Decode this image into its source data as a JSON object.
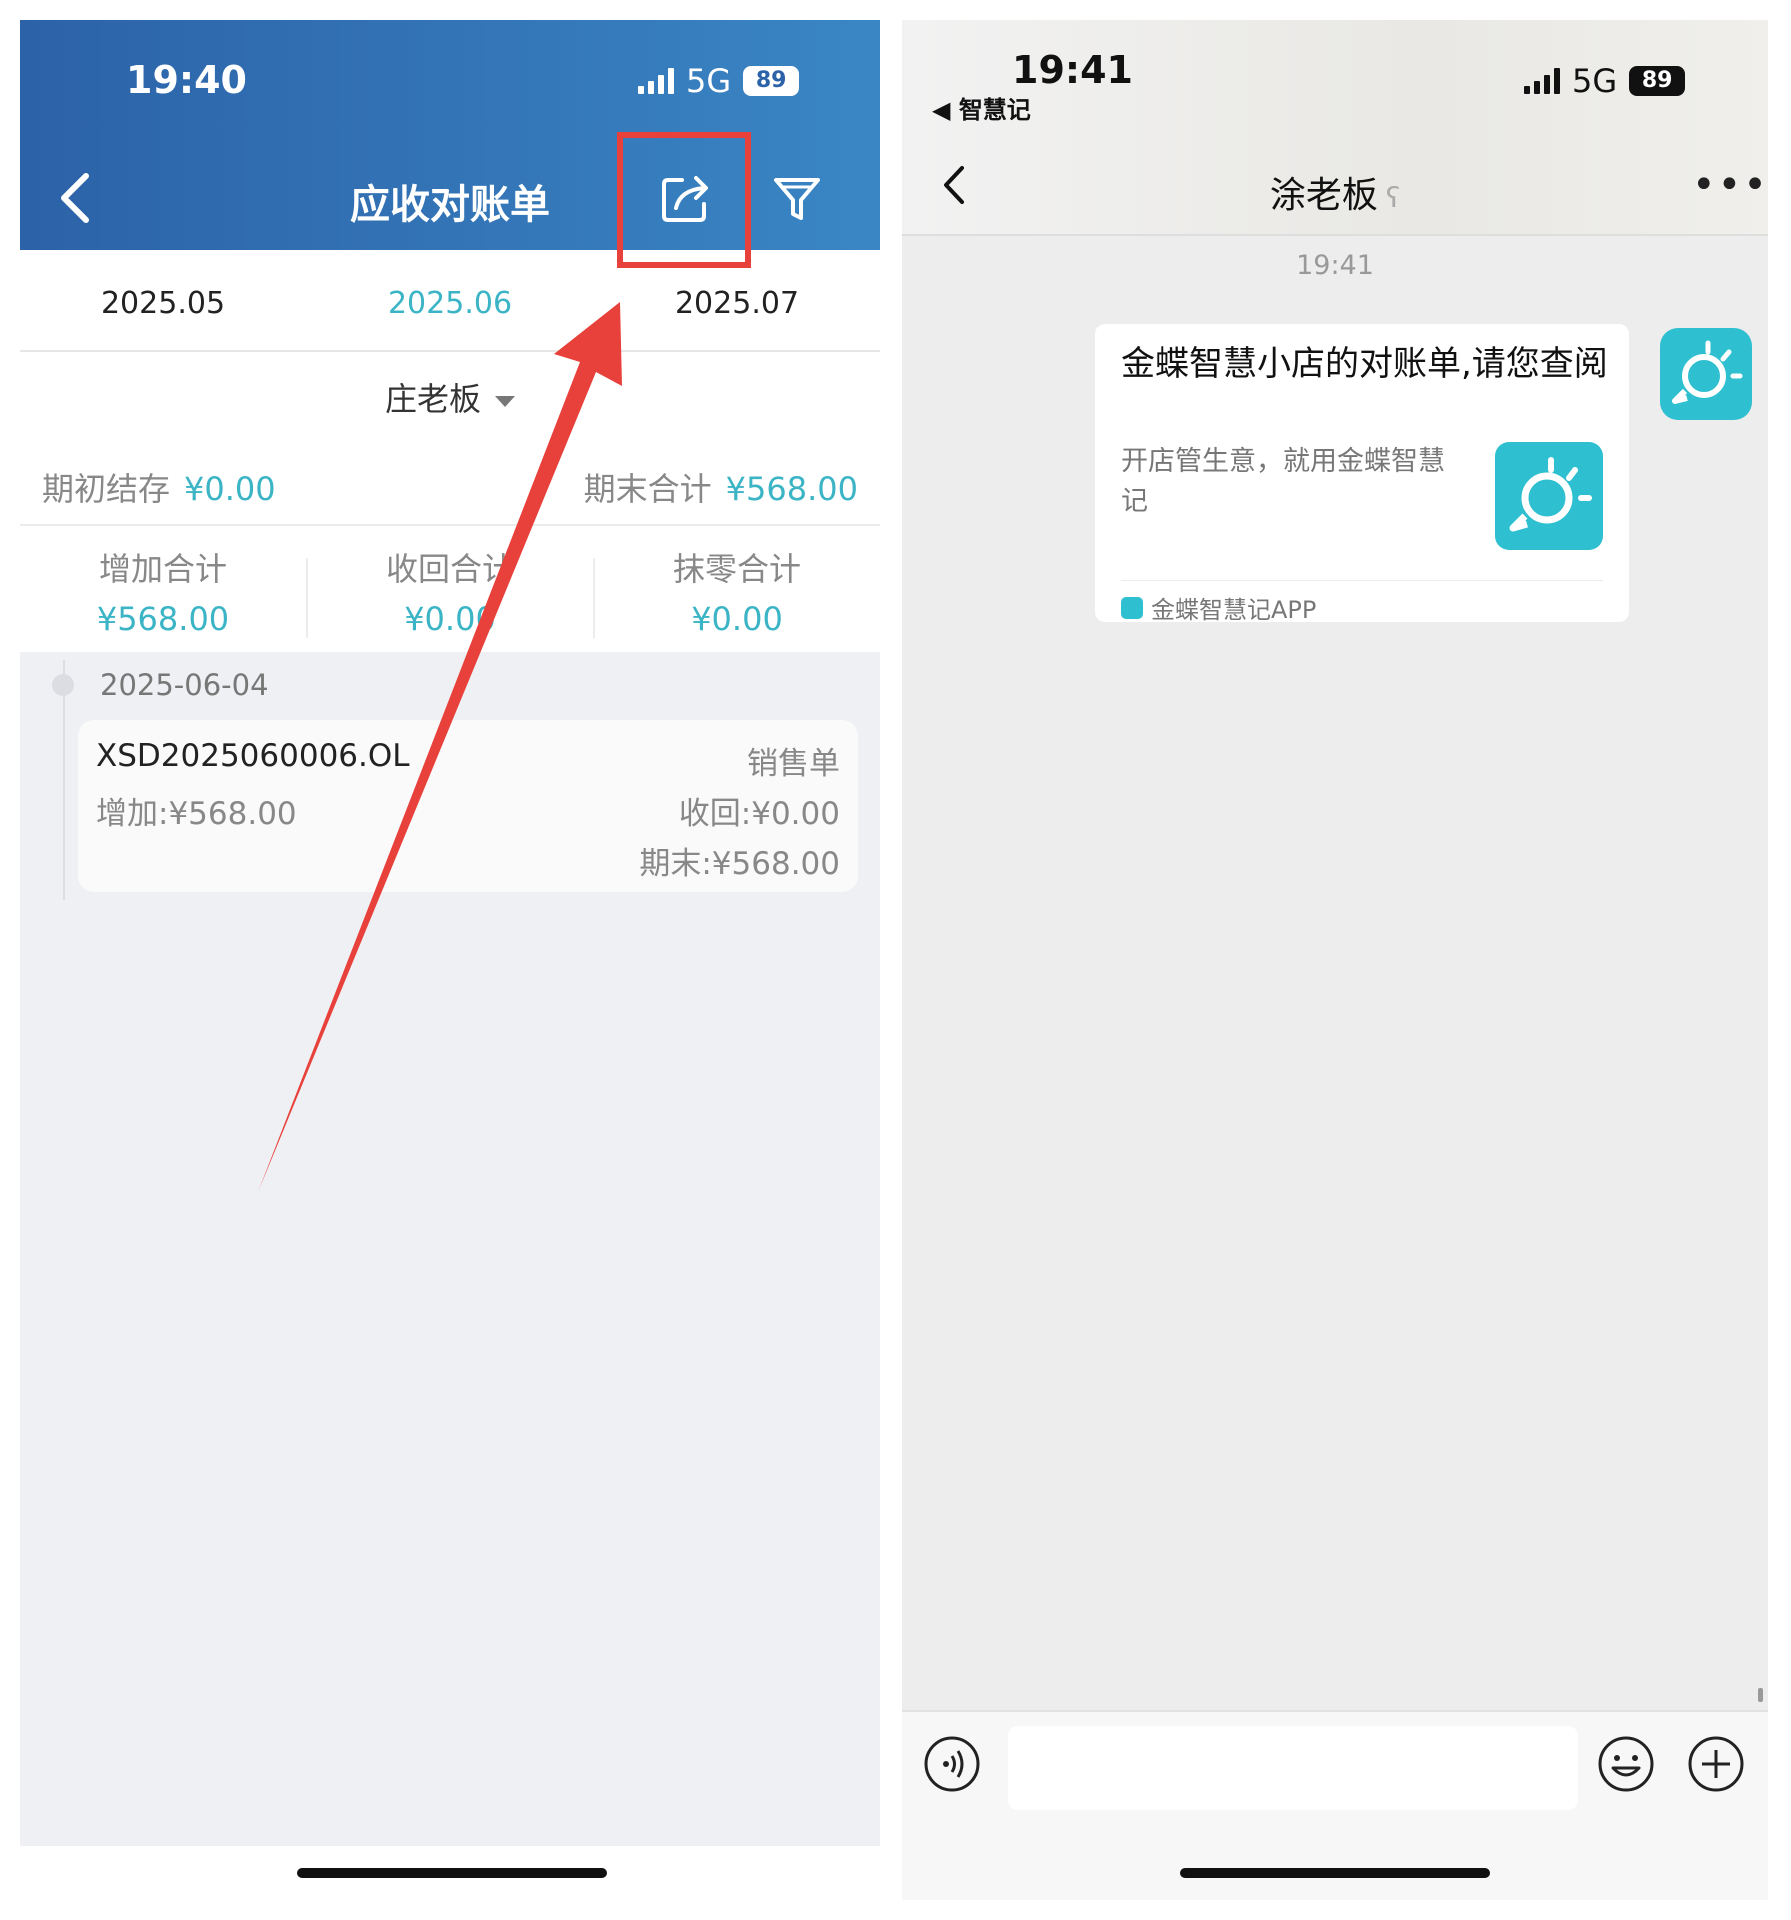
{
  "left_screen": {
    "status": {
      "time": "19:40",
      "network": "5G",
      "battery": "89"
    },
    "nav": {
      "title": "应收对账单"
    },
    "months": [
      {
        "label": "2025.05",
        "active": false
      },
      {
        "label": "2025.06",
        "active": true
      },
      {
        "label": "2025.07",
        "active": false
      }
    ],
    "customer": "庄老板",
    "opening": {
      "label": "期初结存",
      "value": "¥0.00"
    },
    "closing": {
      "label": "期末合计",
      "value": "¥568.00"
    },
    "stats": [
      {
        "label": "增加合计",
        "value": "¥568.00"
      },
      {
        "label": "收回合计",
        "value": "¥0.00"
      },
      {
        "label": "抹零合计",
        "value": "¥0.00"
      }
    ],
    "timeline_date": "2025-06-04",
    "record": {
      "number": "XSD2025060006.OL",
      "type": "销售单",
      "increase": "增加:¥568.00",
      "received": "收回:¥0.00",
      "ending": "期末:¥568.00"
    }
  },
  "right_screen": {
    "status": {
      "time": "19:41",
      "back_app": "◀ 智慧记",
      "network": "5G",
      "battery": "89"
    },
    "chat_title": "涂老板",
    "timestamp": "19:41",
    "message": {
      "title": "金蝶智慧小店的对账单,请您查阅",
      "description": "开店管生意，就用金蝶智慧记",
      "source": "金蝶智慧记APP"
    }
  },
  "icons": {
    "back": "chevron-left-icon",
    "share": "share-icon",
    "filter": "filter-icon",
    "more": "more-icon",
    "voice": "voice-icon",
    "emoji": "emoji-icon",
    "add": "plus-circle-icon",
    "app_logo": "bulb-logo-icon"
  },
  "colors": {
    "header_blue": "#2c62a8",
    "accent_teal": "#3bb4c6",
    "highlight_red": "#e8403a",
    "app_teal": "#2ec0d0"
  }
}
